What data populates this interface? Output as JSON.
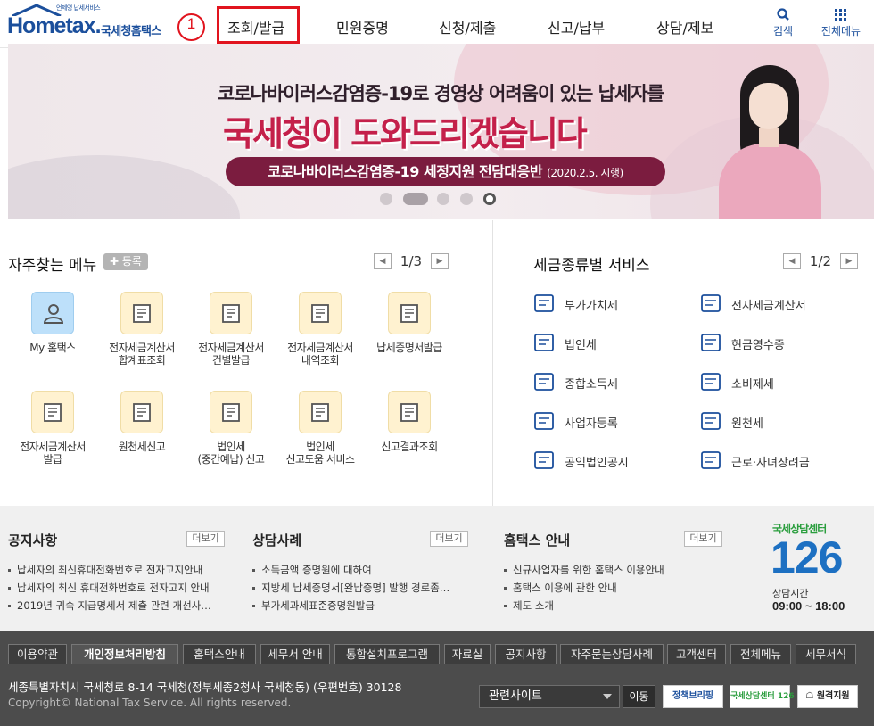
{
  "header": {
    "logo": {
      "tagline": "언제영 납세서비스",
      "wordmark": "Hometax.",
      "name": "국세청홈택스"
    },
    "step_marker": "1",
    "nav": [
      "조회/발급",
      "민원증명",
      "신청/제출",
      "신고/납부",
      "상담/제보"
    ],
    "utility": [
      {
        "label": "검색",
        "icon": "search-icon"
      },
      {
        "label": "전체메뉴",
        "icon": "grid-menu-icon"
      }
    ],
    "colors": {
      "brand": "#1b4f9c",
      "highlight": "#e1141e"
    }
  },
  "banner": {
    "line1": "코로나바이러스감염증-19로 경영상 어려움이 있는 납세자를",
    "line2": "국세청이 도와드리겠습니다",
    "pill_main": "코로나바이러스감염증-19 세정지원 전담대응반",
    "pill_date": "(2020.2.5. 시행)",
    "slide_count": 5,
    "active_slide": 5
  },
  "favorites": {
    "title": "자주찾는 메뉴",
    "register": "등록",
    "page": "1/3",
    "items": [
      {
        "label": "My 홈택스",
        "icon": "person-icon"
      },
      {
        "label": "전자세금계산서\n합계표조회",
        "icon": "invoice-sum-icon"
      },
      {
        "label": "전자세금계산서\n건별발급",
        "icon": "invoice-issue-icon"
      },
      {
        "label": "전자세금계산서\n내역조회",
        "icon": "invoice-search-icon"
      },
      {
        "label": "납세증명서발급",
        "icon": "certificate-icon"
      },
      {
        "label": "전자세금계산서\n발급",
        "icon": "invoice-icon"
      },
      {
        "label": "원천세신고",
        "icon": "calendar-edit-icon"
      },
      {
        "label": "법인세\n(중간예납) 신고",
        "icon": "building-doc-icon"
      },
      {
        "label": "법인세\n신고도움 서비스",
        "icon": "won-doc-icon"
      },
      {
        "label": "신고결과조회",
        "icon": "won-search-icon"
      }
    ]
  },
  "tax_services": {
    "title": "세금종류별 서비스",
    "page": "1/2",
    "items": [
      {
        "label": "부가가치세",
        "icon": "vat-icon"
      },
      {
        "label": "전자세금계산서",
        "icon": "calculator-icon"
      },
      {
        "label": "법인세",
        "icon": "building-icon"
      },
      {
        "label": "현금영수증",
        "icon": "cash-receipt-icon"
      },
      {
        "label": "종합소득세",
        "icon": "money-bag-icon"
      },
      {
        "label": "소비제세",
        "icon": "diamond-icon"
      },
      {
        "label": "사업자등록",
        "icon": "user-icon"
      },
      {
        "label": "원천세",
        "icon": "document-sal-icon"
      },
      {
        "label": "공익법인공시",
        "icon": "clipboard-icon"
      },
      {
        "label": "근로·자녀장려금",
        "icon": "heart-hands-icon"
      }
    ]
  },
  "boards": [
    {
      "title": "공지사항",
      "more": "더보기",
      "items": [
        "납세자의 최신휴대전화번호로 전자고지안내",
        "납세자의 최신 휴대전화번호로 전자고지 안내",
        "2019년 귀속 지급명세서 제출 관련 개선사…"
      ]
    },
    {
      "title": "상담사례",
      "more": "더보기",
      "items": [
        "소득금액 증명원에 대하여",
        "지방세 납세증명서[완납증명] 발행 경로좀…",
        "부가세과세표준증명원발급"
      ]
    },
    {
      "title": "홈택스 안내",
      "more": "더보기",
      "items": [
        "신규사업자를 위한 홈택스 이용안내",
        "홈택스 이용에 관한 안내",
        "제도 소개"
      ]
    }
  ],
  "call_center": {
    "title": "국세상담센터",
    "number": "126",
    "hours_label": "상담시간",
    "hours": "09:00 ~ 18:00"
  },
  "footer": {
    "links": [
      "이용약관",
      "개인정보처리방침",
      "홈택스안내",
      "세무서 안내",
      "통합설치프로그램",
      "자료실",
      "공지사항",
      "자주묻는상담사례",
      "고객센터",
      "전체메뉴",
      "세무서식"
    ],
    "address": "세종특별자치시 국세청로 8-14 국세청(정부세종2청사 국세청동) (우편번호) 30128",
    "copyright": "Copyright© National Tax Service. All rights reserved.",
    "related_select": "관련사이트",
    "go": "이동",
    "badges": [
      "정책브리핑",
      "국세상담센터 126",
      "원격지원"
    ]
  }
}
